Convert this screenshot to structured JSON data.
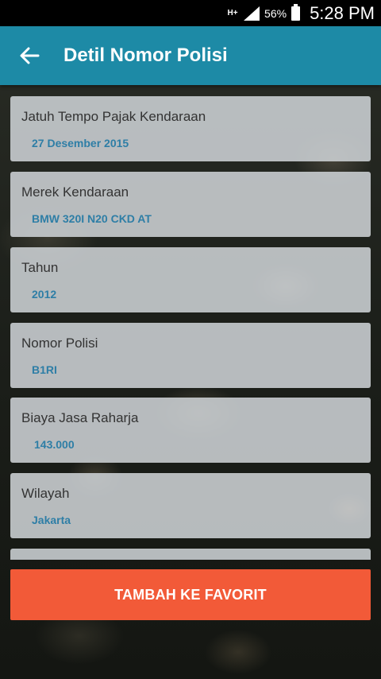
{
  "status_bar": {
    "network": "H+",
    "battery_percent": "56%",
    "time": "5:28 PM",
    "icons": [
      "signal-icon",
      "battery-icon"
    ]
  },
  "app_bar": {
    "title": "Detil Nomor Polisi",
    "back_icon": "arrow-left-icon",
    "color": "#1d8aa6"
  },
  "details": [
    {
      "label": "Jatuh Tempo Pajak Kendaraan",
      "value": "27 Desember 2015"
    },
    {
      "label": "Merek Kendaraan",
      "value": "BMW 320I N20 CKD AT"
    },
    {
      "label": "Tahun",
      "value": "2012"
    },
    {
      "label": "Nomor Polisi",
      "value": "B1RI"
    },
    {
      "label": "Biaya Jasa Raharja",
      "value": "143.000"
    },
    {
      "label": "Wilayah",
      "value": "Jakarta"
    },
    {
      "label": "",
      "value": ""
    }
  ],
  "favorite_button": {
    "label": "TAMBAH KE FAVORIT",
    "color": "#f25a38"
  }
}
